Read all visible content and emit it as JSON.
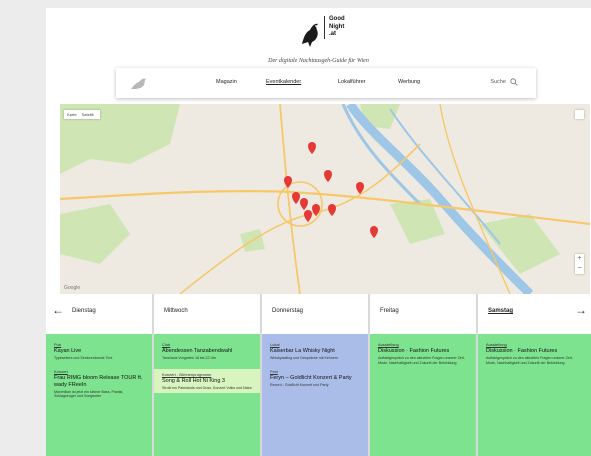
{
  "header": {
    "logo_text_line1": "Good",
    "logo_text_line2": "Night",
    "logo_text_line3": ".at",
    "tagline": "Der digitale Nachtausgeh-Guide für Wien"
  },
  "nav": {
    "items": [
      {
        "label": "Magazin"
      },
      {
        "label": "Eventkalender"
      },
      {
        "label": "Lokalführer"
      },
      {
        "label": "Werbung"
      }
    ],
    "active_index": 1,
    "search_label": "Suche"
  },
  "map": {
    "type_map": "Karte",
    "type_sat": "Satellit",
    "zoom_in": "+",
    "zoom_out": "−",
    "attribution": "Google",
    "colors": {
      "land": "#eeeae2",
      "park": "#cfe5b4",
      "water": "#9ec6e6",
      "road": "#f6c86a",
      "pin": "#e53935"
    }
  },
  "days": {
    "prev_arrow": "←",
    "next_arrow": "→",
    "columns": [
      {
        "name": "Dienstag",
        "color": "#7de38e",
        "events": [
          {
            "category": "Pub",
            "title": "Kayan Live",
            "desc": "Typewriters und Seniorenbands Tirol"
          },
          {
            "category": "Konzert",
            "title": "Frau RIMG bloom Release TOUR ft. wady FReeIn",
            "desc": "Maximilian ist jetzt ein kleiner Bass, Pianist, Schlagzeuger und Songwriter"
          }
        ]
      },
      {
        "name": "Mittwoch",
        "color": "#7de38e",
        "events": [
          {
            "category": "Club",
            "title": "Abendessen Tanzabendwahl",
            "desc": "Tanzhaus Vorgarten 18 bis 22 Uhr"
          },
          {
            "category": "Konzert - Bühnenprogramm",
            "title": "Song & Roll Hot Ni King 3",
            "desc": "Stroik'mn Palmlands und Guss, Konzert Volks und Natur"
          }
        ]
      },
      {
        "name": "Donnerstag",
        "color": "#a9bde8",
        "events": [
          {
            "category": "Lokal",
            "title": "Kaiserbar La Whisky Night",
            "desc": "Whiskytasting und Gespräche mit Kennern"
          },
          {
            "category": "Fest",
            "title": "Feryn – Goldlicht Konzert & Party",
            "desc": "Record - Goldlicht Konzert und Party"
          }
        ]
      },
      {
        "name": "Freitag",
        "color": "#7de38e",
        "events": [
          {
            "category": "Ausstellung",
            "title": "Diskussion · Fashion Futures",
            "desc": "Auftaktgespräch zu den aktuellen Fragen unserer Zeit, Mode, Nachhaltigkeit und Zukunft der Bekleidung"
          }
        ]
      },
      {
        "name": "Samstag",
        "color": "#7de38e",
        "events": [
          {
            "category": "Ausstellung",
            "title": "Diskussion · Fashion Futures",
            "desc": "Auftaktgespräch zu den aktuellen Fragen unserer Zeit, Mode, Nachhaltigkeit und Zukunft der Bekleidung"
          }
        ]
      }
    ],
    "active_index": 4
  }
}
